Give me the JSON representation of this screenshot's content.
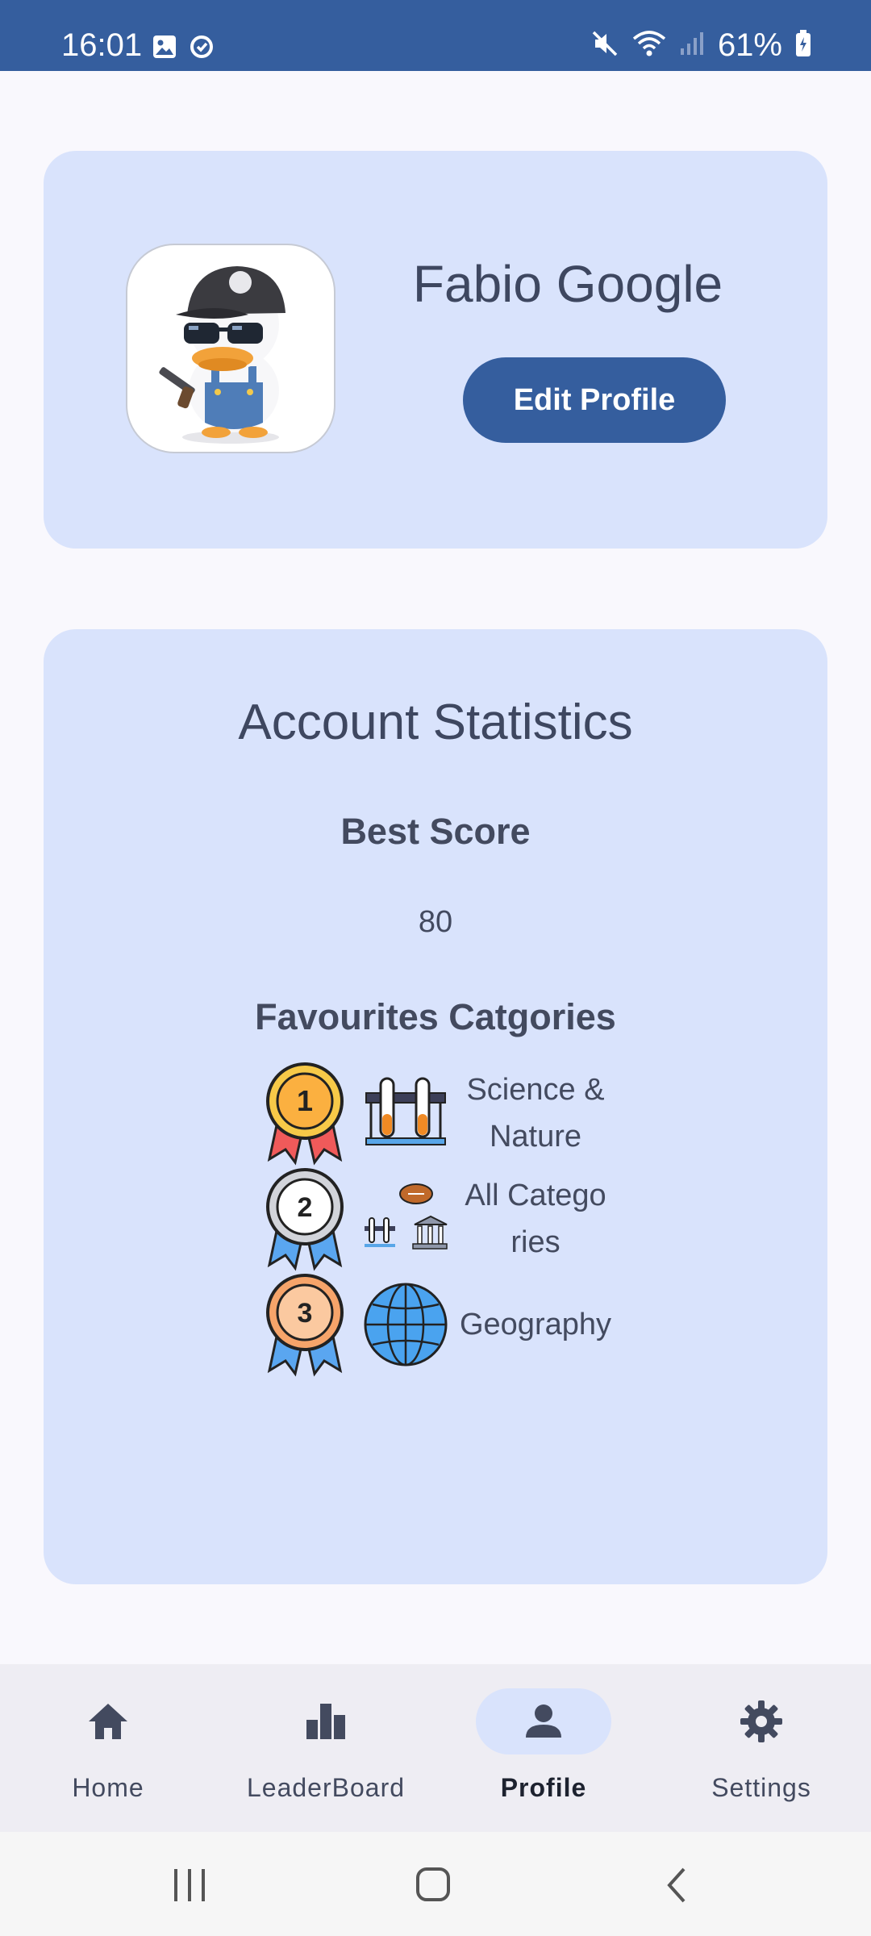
{
  "status_bar": {
    "time": "16:01",
    "battery": "61%",
    "icons": [
      "image-icon",
      "sync-icon",
      "mute-icon",
      "wifi-icon",
      "signal-icon",
      "battery-icon"
    ]
  },
  "profile": {
    "name": "Fabio Google",
    "edit_button_label": "Edit Profile",
    "avatar_icon": "duck-avatar-icon"
  },
  "stats": {
    "title": "Account Statistics",
    "best_score_label": "Best Score",
    "best_score_value": "80",
    "favourites_label": "Favourites Catgories",
    "favourites": [
      {
        "rank": "1",
        "name": "Science & Nature",
        "icon": "test-tubes-icon"
      },
      {
        "rank": "2",
        "name": "All Catego ries",
        "icon": "all-categories-icon"
      },
      {
        "rank": "3",
        "name": "Geography",
        "icon": "globe-icon"
      }
    ]
  },
  "bottom_nav": {
    "items": [
      {
        "label": "Home",
        "icon": "home-icon"
      },
      {
        "label": "LeaderBoard",
        "icon": "leaderboard-icon"
      },
      {
        "label": "Profile",
        "icon": "person-icon",
        "active": true
      },
      {
        "label": "Settings",
        "icon": "gear-icon"
      }
    ]
  },
  "colors": {
    "accent": "#355e9e",
    "card": "#d9e3fc",
    "background": "#f9f8fd",
    "nav_background": "#eeedf3"
  }
}
